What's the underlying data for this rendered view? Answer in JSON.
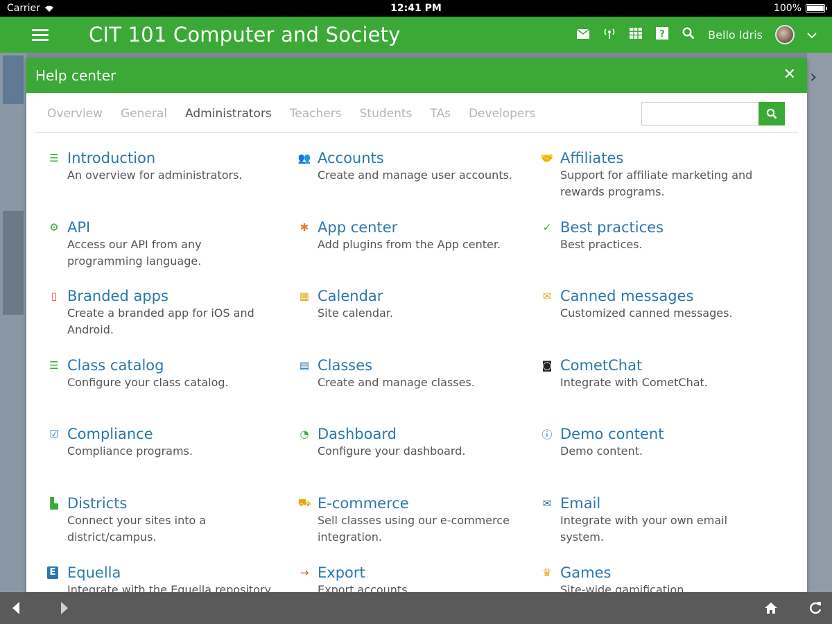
{
  "status_bar": {
    "carrier": "Carrier",
    "time": "12:41 PM",
    "battery": "100%"
  },
  "app_bar": {
    "title": "CIT 101 Computer and Society",
    "user_name": "Bello Idris"
  },
  "modal": {
    "title": "Help center",
    "tabs": [
      {
        "label": "Overview",
        "active": false
      },
      {
        "label": "General",
        "active": false
      },
      {
        "label": "Administrators",
        "active": true
      },
      {
        "label": "Teachers",
        "active": false
      },
      {
        "label": "Students",
        "active": false
      },
      {
        "label": "TAs",
        "active": false
      },
      {
        "label": "Developers",
        "active": false
      }
    ],
    "search_placeholder": "",
    "topics": [
      {
        "title": "Introduction",
        "desc": "An overview for administrators.",
        "icon": "list-icon",
        "color": "#3aa935"
      },
      {
        "title": "Accounts",
        "desc": "Create and manage user accounts.",
        "icon": "users-icon",
        "color": "#2a78ad"
      },
      {
        "title": "Affiliates",
        "desc": "Support for affiliate marketing and rewards programs.",
        "icon": "handshake-icon",
        "color": "#2a78ad"
      },
      {
        "title": "API",
        "desc": "Access our API from any programming language.",
        "icon": "gear-icon",
        "color": "#3aa935"
      },
      {
        "title": "App center",
        "desc": "Add plugins from the App center.",
        "icon": "puzzle-icon",
        "color": "#e67e22"
      },
      {
        "title": "Best practices",
        "desc": "Best practices.",
        "icon": "check-icon",
        "color": "#3aa935"
      },
      {
        "title": "Branded apps",
        "desc": "Create a branded app for iOS and Android.",
        "icon": "mobile-icon",
        "color": "#e74c3c"
      },
      {
        "title": "Calendar",
        "desc": "Site calendar.",
        "icon": "calendar-icon",
        "color": "#e6a817"
      },
      {
        "title": "Canned messages",
        "desc": "Customized canned messages.",
        "icon": "comments-icon",
        "color": "#e6a817"
      },
      {
        "title": "Class catalog",
        "desc": "Configure your class catalog.",
        "icon": "list-icon",
        "color": "#3aa935"
      },
      {
        "title": "Classes",
        "desc": "Create and manage classes.",
        "icon": "classes-icon",
        "color": "#2a78ad"
      },
      {
        "title": "CometChat",
        "desc": "Integrate with CometChat.",
        "icon": "cometchat-icon",
        "color": "#222222"
      },
      {
        "title": "Compliance",
        "desc": "Compliance programs.",
        "icon": "clipboard-icon",
        "color": "#2a78ad"
      },
      {
        "title": "Dashboard",
        "desc": "Configure your dashboard.",
        "icon": "dashboard-icon",
        "color": "#3aa935"
      },
      {
        "title": "Demo content",
        "desc": "Demo content.",
        "icon": "info-icon",
        "color": "#2a78ad"
      },
      {
        "title": "Districts",
        "desc": "Connect your sites into a district/campus.",
        "icon": "districts-icon",
        "color": "#3aa935"
      },
      {
        "title": "E-commerce",
        "desc": "Sell classes using our e-commerce integration.",
        "icon": "cart-icon",
        "color": "#e6a817"
      },
      {
        "title": "Email",
        "desc": "Integrate with your own email system.",
        "icon": "envelope-icon",
        "color": "#2a78ad"
      },
      {
        "title": "Equella",
        "desc": "Integrate with the Equella repository.",
        "icon": "equella-icon",
        "color": "#2a78ad"
      },
      {
        "title": "Export",
        "desc": "Export accounts.",
        "icon": "arrow-right-icon",
        "color": "#d35400"
      },
      {
        "title": "Games",
        "desc": "Site-wide gamification.",
        "icon": "trophy-icon",
        "color": "#e6a817"
      }
    ]
  }
}
